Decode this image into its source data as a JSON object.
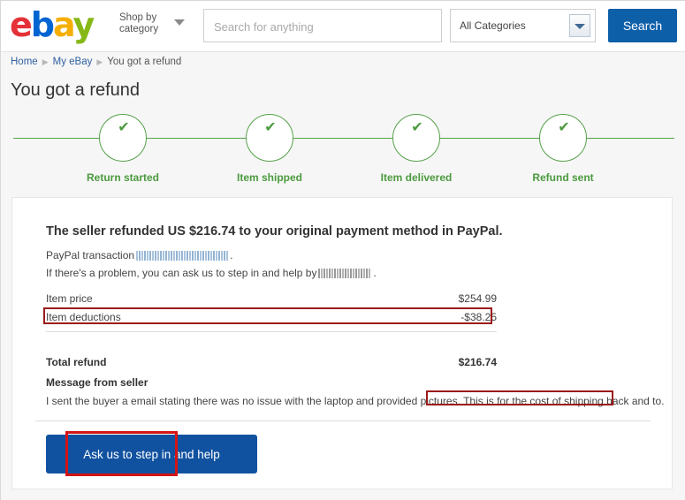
{
  "header": {
    "logo": {
      "e": "e",
      "b": "b",
      "a": "a",
      "y": "y"
    },
    "shop_by_category": "Shop by category",
    "search_placeholder": "Search for anything",
    "search_value": "",
    "category_selected": "All Categories",
    "search_button": "Search"
  },
  "breadcrumb": {
    "home": "Home",
    "my_ebay": "My eBay",
    "current": "You got a refund",
    "separator": "▶"
  },
  "page_title": "You got a refund",
  "stepper": {
    "check_glyph": "✔",
    "steps": [
      {
        "label": "Return started",
        "complete": true
      },
      {
        "label": "Item shipped",
        "complete": true
      },
      {
        "label": "Item delivered",
        "complete": true
      },
      {
        "label": "Refund sent",
        "complete": true
      }
    ]
  },
  "card": {
    "heading": "The seller refunded US $216.74 to your original payment method in PayPal.",
    "paypal_transaction_prefix": "PayPal transaction",
    "paypal_transaction_redacted": true,
    "paypal_transaction_suffix": ".",
    "problem_prefix": "If there's a problem, you can ask us to step in and help by",
    "problem_redacted": true,
    "problem_suffix": ".",
    "price_rows": [
      {
        "label": "Item price",
        "value": "$254.99"
      },
      {
        "label": "Item deductions",
        "value": "-$38.25"
      }
    ],
    "total": {
      "label": "Total refund",
      "value": "$216.74"
    },
    "message_title": "Message from seller",
    "message_body_part1": "I sent the buyer a email stating there was no issue with the laptop and provided pictures.",
    "message_body_part2": "This is for the cost of shipping back and to.",
    "ask_button": "Ask us to step in and help"
  },
  "annotations": {
    "deductions_box_color": "#9c1a1a",
    "message_box_color": "#9c1a1a",
    "button_box_color": "#d41414"
  },
  "colors": {
    "ebay_red": "#e53238",
    "ebay_blue": "#0064d2",
    "ebay_yellow": "#f5af02",
    "ebay_green": "#86b817",
    "progress_green": "#4c9a3f",
    "primary_blue": "#1152a0",
    "page_background": "#f6f6f6"
  }
}
